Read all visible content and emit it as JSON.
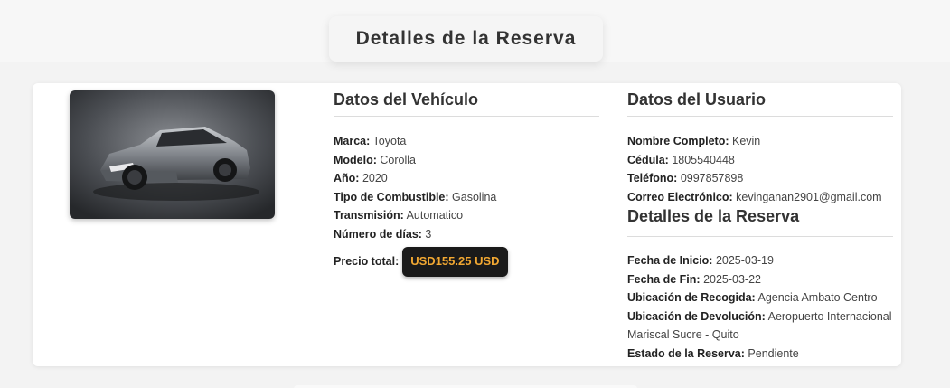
{
  "header": {
    "title": "Detalles de la Reserva"
  },
  "vehicle": {
    "image_alt": "car-photo",
    "section_title": "Datos del Vehículo",
    "fields": [
      {
        "label": "Marca:",
        "value": "Toyota"
      },
      {
        "label": "Modelo:",
        "value": "Corolla"
      },
      {
        "label": "Año:",
        "value": "2020"
      },
      {
        "label": "Tipo de Combustible:",
        "value": "Gasolina"
      },
      {
        "label": "Transmisión:",
        "value": "Automatico"
      },
      {
        "label": "Número de días:",
        "value": "3"
      }
    ],
    "price_label": "Precio total:",
    "price_value": "USD155.25 USD"
  },
  "user": {
    "section_title": "Datos del Usuario",
    "fields": [
      {
        "label": "Nombre Completo:",
        "value": "Kevin"
      },
      {
        "label": "Cédula:",
        "value": "1805540448"
      },
      {
        "label": "Teléfono:",
        "value": "0997857898"
      },
      {
        "label": "Correo Electrónico:",
        "value": "kevinganan2901@gmail.com"
      }
    ]
  },
  "reservation": {
    "section_title": "Detalles de la Reserva",
    "fields": [
      {
        "label": "Fecha de Inicio:",
        "value": "2025-03-19"
      },
      {
        "label": "Fecha de Fin:",
        "value": "2025-03-22"
      },
      {
        "label": "Ubicación de Recogida:",
        "value": "Agencia Ambato Centro"
      },
      {
        "label": "Ubicación de Devolución:",
        "value": "Aeropuerto Internacional Mariscal Sucre - Quito"
      },
      {
        "label": "Estado de la Reserva:",
        "value": "Pendiente"
      }
    ]
  },
  "colors": {
    "price_bg": "#1a1a1a",
    "price_text": "#f2a832"
  }
}
